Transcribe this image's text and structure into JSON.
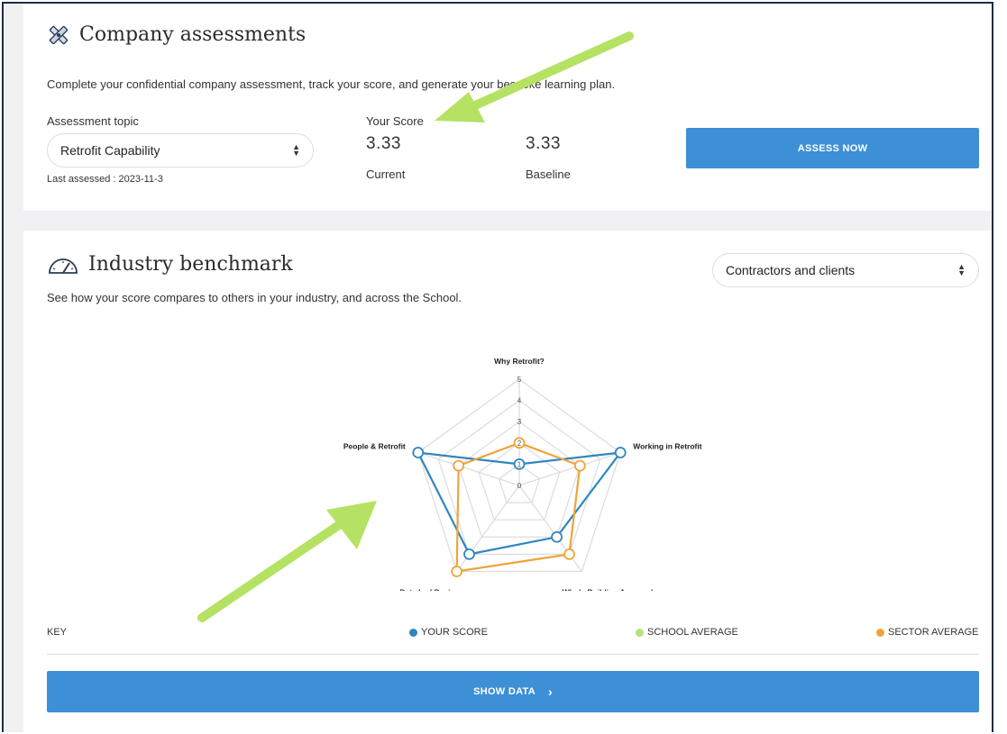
{
  "assessments": {
    "title": "Company assessments",
    "description": "Complete your confidential company assessment, track your score, and generate your bespoke learning plan.",
    "topic_label": "Assessment topic",
    "topic_value": "Retrofit Capability",
    "last_assessed": "Last assessed : 2023-11-3",
    "your_score_label": "Your Score",
    "current_value": "3.33",
    "current_label": "Current",
    "baseline_value": "3.33",
    "baseline_label": "Baseline",
    "assess_button": "ASSESS NOW"
  },
  "benchmark": {
    "title": "Industry benchmark",
    "description": "See how your score compares to others in your industry, and across the School.",
    "group_select": "Contractors and clients",
    "key_label": "KEY",
    "legend": [
      {
        "label": "YOUR SCORE",
        "color": "#2f86c0"
      },
      {
        "label": "SCHOOL AVERAGE",
        "color": "#b5e27a"
      },
      {
        "label": "SECTOR AVERAGE",
        "color": "#f0a33c"
      }
    ],
    "show_data_button": "SHOW DATA",
    "show_data_icon": "chevron-right-icon"
  },
  "chart_data": {
    "type": "radar",
    "axes": [
      "Why Retrofit?",
      "Working in Retrofit",
      "Whole Building Approach",
      "Data Led Design",
      "People & Retrofit"
    ],
    "ticks": [
      "0",
      "1",
      "2",
      "3",
      "4",
      "5"
    ],
    "range": [
      0,
      5
    ],
    "series": [
      {
        "name": "YOUR SCORE",
        "color": "#2f86c0",
        "values": [
          1,
          5,
          3,
          4,
          5
        ]
      },
      {
        "name": "SECTOR AVERAGE",
        "color": "#f0a33c",
        "values": [
          2,
          3,
          4,
          5,
          3
        ]
      }
    ]
  },
  "annotations": {
    "arrow_color": "#b5e262"
  }
}
